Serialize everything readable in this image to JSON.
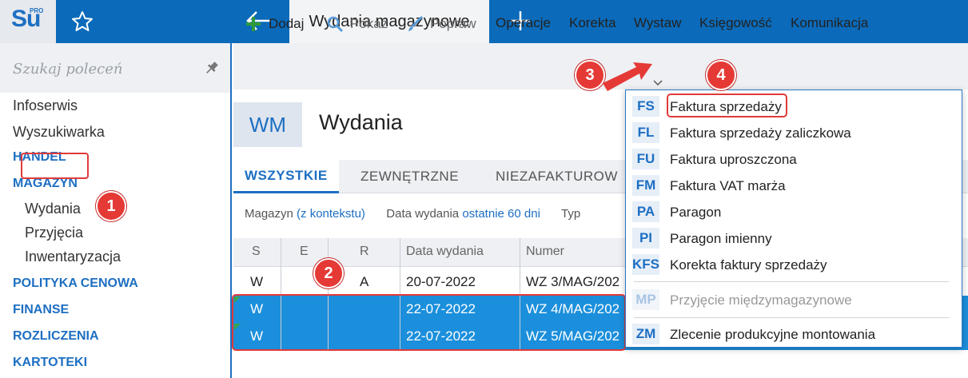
{
  "app": {
    "logo_text": "Su",
    "logo_sup": "PRO",
    "active_tab": "Wydania magazynowe"
  },
  "sidebar": {
    "search_placeholder": "Szukaj poleceń",
    "items": [
      {
        "label": "Infoserwis",
        "type": "item"
      },
      {
        "label": "Wyszukiwarka",
        "type": "item"
      },
      {
        "label": "HANDEL",
        "type": "head"
      },
      {
        "label": "MAGAZYN",
        "type": "head"
      },
      {
        "label": "Wydania",
        "type": "sub"
      },
      {
        "label": "Przyjęcia",
        "type": "sub"
      },
      {
        "label": "Inwentaryzacja",
        "type": "sub"
      },
      {
        "label": "POLITYKA CENOWA",
        "type": "head"
      },
      {
        "label": "FINANSE",
        "type": "head"
      },
      {
        "label": "ROZLICZENIA",
        "type": "head"
      },
      {
        "label": "KARTOTEKI",
        "type": "head"
      }
    ]
  },
  "toolbar": {
    "dodaj": "Dodaj",
    "pokaz": "Pokaż",
    "popraw": "Popraw",
    "operacje": "Operacje",
    "korekta": "Korekta",
    "wystaw": "Wystaw",
    "ksiegowosc": "Księgowość",
    "komunikacja": "Komunikacja"
  },
  "header": {
    "badge": "WM",
    "title": "Wydania"
  },
  "tabs": [
    "WSZYSTKIE",
    "ZEWNĘTRZNE",
    "NIEZAFAKTUROW"
  ],
  "filters": {
    "magazyn_label": "Magazyn",
    "magazyn_value": "(z kontekstu)",
    "data_label": "Data wydania",
    "data_value": "ostatnie 60 dni",
    "typ_label": "Typ"
  },
  "grid": {
    "columns": [
      "S",
      "E",
      "R",
      "Data wydania",
      "Numer"
    ],
    "rows": [
      {
        "s": "W",
        "e": "",
        "r": "A",
        "date": "20-07-2022",
        "num": "WZ 3/MAG/202",
        "selected": false
      },
      {
        "s": "W",
        "e": "",
        "r": "",
        "date": "22-07-2022",
        "num": "WZ 4/MAG/202",
        "selected": true
      },
      {
        "s": "W",
        "e": "",
        "r": "",
        "date": "22-07-2022",
        "num": "WZ 5/MAG/202",
        "selected": true
      }
    ]
  },
  "dropdown": {
    "items": [
      {
        "code": "FS",
        "label": "Faktura sprzedaży",
        "disabled": false
      },
      {
        "code": "FL",
        "label": "Faktura sprzedaży zaliczkowa",
        "disabled": false
      },
      {
        "code": "FU",
        "label": "Faktura uproszczona",
        "disabled": false
      },
      {
        "code": "FM",
        "label": "Faktura VAT marża",
        "disabled": false
      },
      {
        "code": "PA",
        "label": "Paragon",
        "disabled": false
      },
      {
        "code": "PI",
        "label": "Paragon imienny",
        "disabled": false
      },
      {
        "code": "KFS",
        "label": "Korekta faktury sprzedaży",
        "disabled": false
      },
      {
        "code": "MP",
        "label": "Przyjęcie międzymagazynowe",
        "disabled": true
      },
      {
        "code": "ZM",
        "label": "Zlecenie produkcyjne montowania",
        "disabled": false
      }
    ]
  },
  "callouts": [
    "1",
    "2",
    "3",
    "4"
  ],
  "colors": {
    "brand": "#0b6ab9",
    "accent": "#1d6fc2",
    "selection": "#1b8fdc",
    "highlight": "#e03a3a"
  }
}
